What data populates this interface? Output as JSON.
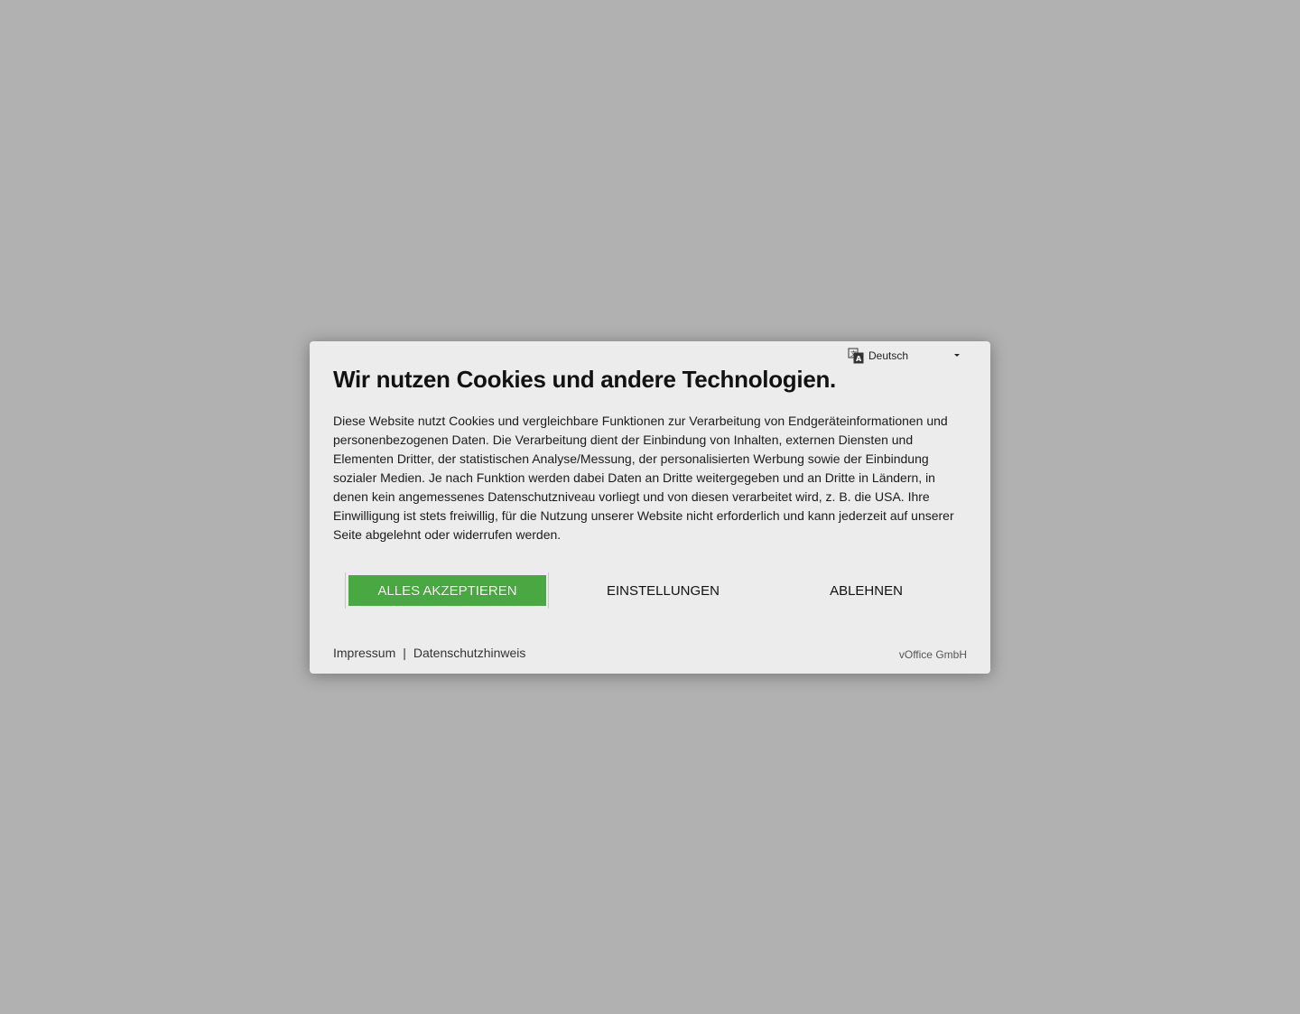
{
  "language_select": {
    "icon": "translate-icon",
    "selected": "Deutsch"
  },
  "dialog": {
    "title": "Wir nutzen Cookies und andere Technologien.",
    "body": "Diese Website nutzt Cookies und vergleichbare Funktionen zur Verarbeitung von Endgeräteinformationen und personenbezogenen Daten. Die Verarbeitung dient der Einbindung von Inhalten, externen Diensten und Elementen Dritter, der statistischen Analyse/Messung, der personalisierten Werbung sowie der Einbindung sozialer Medien. Je nach Funktion werden dabei Daten an Dritte weitergegeben und an Dritte in Ländern, in denen kein angemessenes Datenschutzniveau vorliegt und von diesen verarbeitet wird, z. B. die USA. Ihre Einwilligung ist stets freiwillig, für die Nutzung unserer Website nicht erforderlich und kann jederzeit auf unserer Seite abgelehnt oder widerrufen werden."
  },
  "buttons": {
    "accept_all": "ALLES AKZEPTIEREN",
    "settings": "EINSTELLUNGEN",
    "decline": "ABLEHNEN"
  },
  "footer": {
    "imprint": "Impressum",
    "separator": "|",
    "privacy": "Datenschutzhinweis",
    "provider": "vOffice GmbH"
  },
  "colors": {
    "overlay": "#b1b1b1",
    "dialog_bg": "#ececec",
    "accept_button": "#4aa842"
  }
}
